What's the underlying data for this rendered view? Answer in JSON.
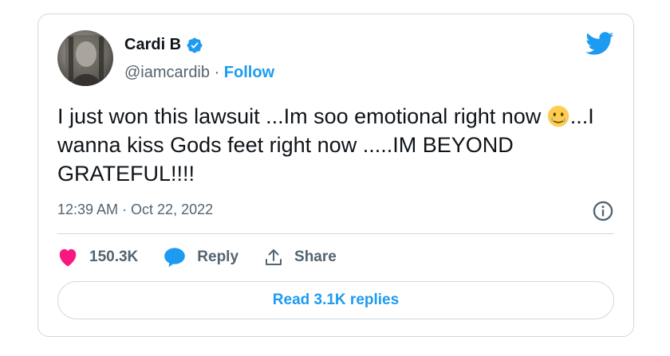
{
  "author": {
    "display_name": "Cardi B",
    "handle": "@iamcardib",
    "separator": "·",
    "follow_label": "Follow"
  },
  "tweet": {
    "text_before_emoji": "I just won this lawsuit ...Im soo emotional right now ",
    "emoji": "face-holding-back-tears",
    "text_after_emoji": "...I wanna kiss Gods feet right now .....IM BEYOND GRATEFUL!!!!",
    "timestamp": "12:39 AM · Oct 22, 2022"
  },
  "actions": {
    "like_count": "150.3K",
    "reply_label": "Reply",
    "share_label": "Share"
  },
  "read_replies_label": "Read 3.1K replies",
  "colors": {
    "accent": "#1d9bf0",
    "like": "#f91880",
    "text": "#0f1419",
    "muted": "#536471",
    "border": "#cfd9de"
  }
}
